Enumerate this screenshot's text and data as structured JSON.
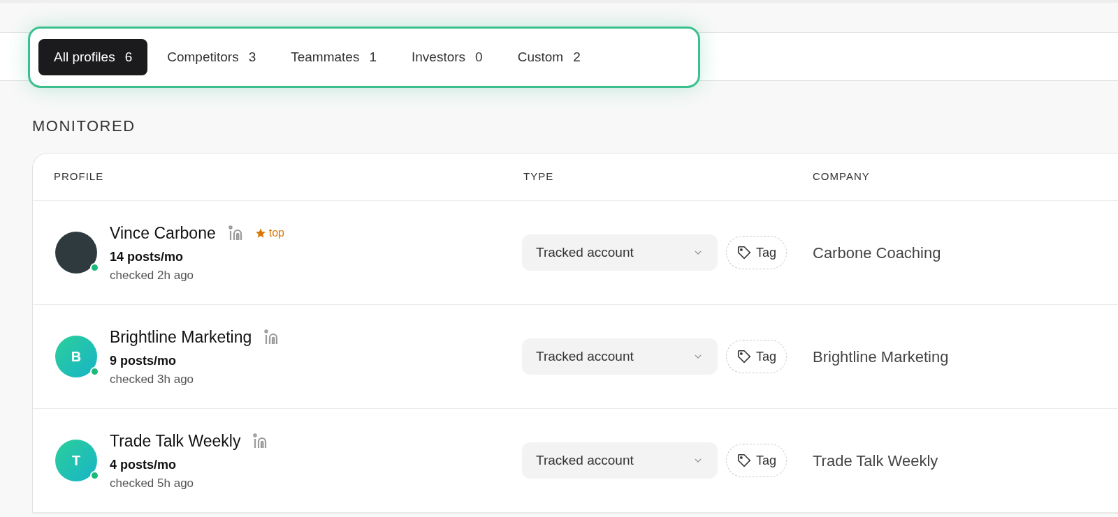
{
  "tabs": [
    {
      "label": "All profiles",
      "count": "6",
      "selected": true
    },
    {
      "label": "Competitors",
      "count": "3",
      "selected": false
    },
    {
      "label": "Teammates",
      "count": "1",
      "selected": false
    },
    {
      "label": "Investors",
      "count": "0",
      "selected": false
    },
    {
      "label": "Custom",
      "count": "2",
      "selected": false
    }
  ],
  "section_title": "MONITORED",
  "table": {
    "columns": [
      "PROFILE",
      "TYPE",
      "COMPANY"
    ],
    "rows": [
      {
        "avatar": {
          "kind": "photo"
        },
        "online": true,
        "name": "Vince Carbone",
        "badge": "top",
        "posts": "14 posts/mo",
        "checked": "checked 2h ago",
        "type": "Tracked account",
        "tag": "Tag",
        "company": "Carbone Coaching"
      },
      {
        "avatar": {
          "kind": "initial",
          "letter": "B"
        },
        "online": true,
        "name": "Brightline Marketing",
        "posts": "9 posts/mo",
        "checked": "checked 3h ago",
        "type": "Tracked account",
        "tag": "Tag",
        "company": "Brightline Marketing"
      },
      {
        "avatar": {
          "kind": "initial",
          "letter": "T"
        },
        "online": true,
        "name": "Trade Talk Weekly",
        "posts": "4 posts/mo",
        "checked": "checked 5h ago",
        "type": "Tracked account",
        "tag": "Tag",
        "company": "Trade Talk Weekly"
      }
    ]
  }
}
